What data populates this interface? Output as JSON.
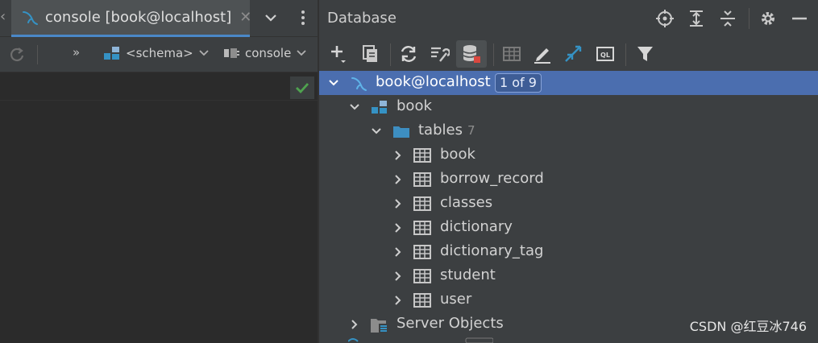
{
  "editor": {
    "tab": {
      "label": "console [book@localhost]",
      "close": "✕"
    },
    "toolbar": {
      "more": "»",
      "schema_label": "<schema>",
      "console_label": "console"
    }
  },
  "database": {
    "title": "Database",
    "tree": {
      "connection": {
        "label": "book@localhost",
        "badge": "1 of 9"
      },
      "schema": {
        "label": "book"
      },
      "tables_folder": {
        "label": "tables",
        "count": "7"
      },
      "tables": [
        {
          "label": "book"
        },
        {
          "label": "borrow_record"
        },
        {
          "label": "classes"
        },
        {
          "label": "dictionary"
        },
        {
          "label": "dictionary_tag"
        },
        {
          "label": "student"
        },
        {
          "label": "user"
        }
      ],
      "server_objects": {
        "label": "Server Objects"
      }
    }
  },
  "watermark": "CSDN @红豆冰746",
  "colors": {
    "selection": "#4b6eaf",
    "accent_blue": "#3592c4",
    "ok_green": "#4fa34f",
    "stop_red": "#d9473f"
  }
}
